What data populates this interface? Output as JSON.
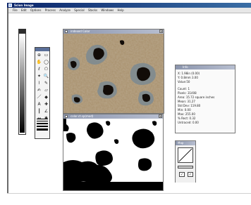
{
  "app": {
    "title": "Scion Image"
  },
  "menu": {
    "items": [
      "File",
      "Edit",
      "Options",
      "Process",
      "Analyze",
      "Special",
      "Stacks",
      "Windows",
      "Help"
    ]
  },
  "windows": {
    "color_image": {
      "title": "indexed Color"
    },
    "binary_image": {
      "title": "color.ct.sp(mod)"
    }
  },
  "tools": {
    "icons": [
      "move-icon",
      "select-rect-icon",
      "hand-icon",
      "select-oval-icon",
      "lasso-icon",
      "polygon-icon",
      "wand-icon",
      "zoom-icon",
      "dropper-icon",
      "pencil-icon",
      "brush-icon",
      "eraser-icon",
      "line-icon",
      "fill-icon",
      "text-icon",
      "crosshair-icon",
      "ruler-icon",
      "angle-icon",
      "scroll-icon",
      "spray-icon"
    ],
    "glyphs": [
      "⊕",
      "▭",
      "✋",
      "◯",
      "ℓ",
      "⬠",
      "✦",
      "🔍",
      "⌇",
      "✎",
      "✍",
      "▱",
      "／",
      "◆",
      "A",
      "✚",
      "┃",
      "∠",
      "↔",
      "✱"
    ]
  },
  "info": {
    "title": "Info",
    "lines": [
      "X: 1.98in (0.00)",
      "Y: 0.8mm  3.00",
      "Value:50",
      "",
      "Count: 1",
      "Pixels: 31408",
      "Area: 15.72 square inches",
      "Mean: 31.27",
      "Std Dev: 119.80",
      "Min: 0.00",
      "Max: 255.00",
      "% Rect: 0.32",
      "Untraced: 0.00"
    ]
  },
  "map": {
    "title": "Map",
    "btn_left": "✓",
    "btn_right": "✓"
  },
  "colors": {
    "title_active": "#0a246a",
    "blob_dark": "#0e0a08",
    "background_tan": "#a8906c"
  }
}
